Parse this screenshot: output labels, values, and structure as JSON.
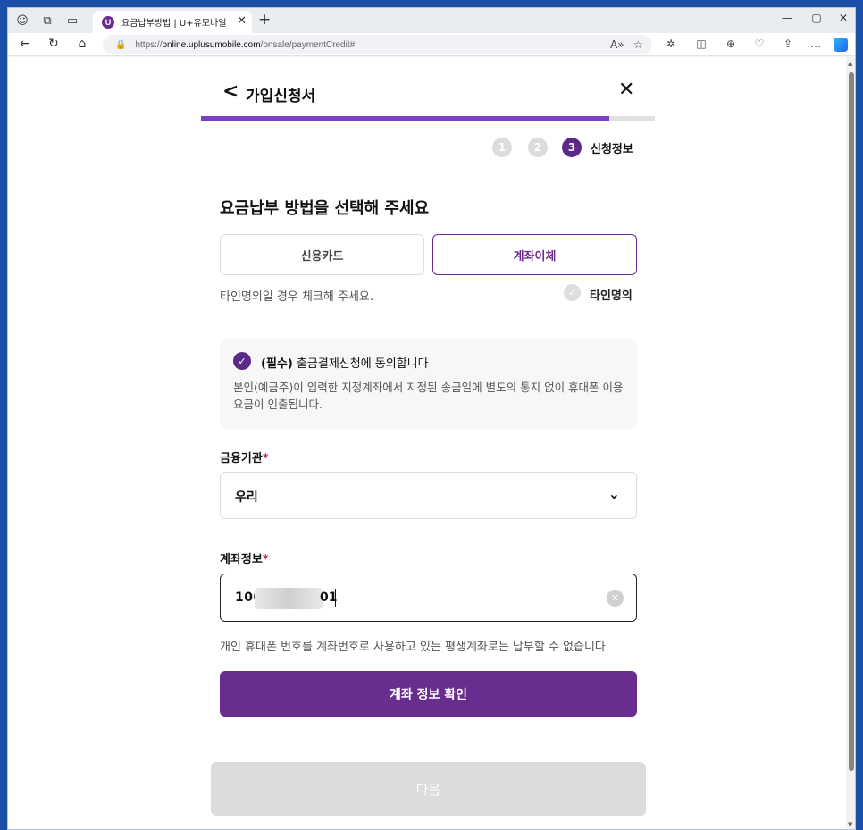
{
  "browser": {
    "tab_title": "요금납부방법 | U+유모바일",
    "tab_favicon": "U",
    "url_prefix": "https://",
    "url_host": "online.uplusumobile.com",
    "url_path": "/onsale/paymentCredit#"
  },
  "header": {
    "title": "가입신청서"
  },
  "progress": {
    "fraction": 0.9
  },
  "steps": [
    {
      "number": "1",
      "active": false
    },
    {
      "number": "2",
      "active": false
    },
    {
      "number": "3",
      "active": true,
      "label": "신청정보"
    }
  ],
  "payment": {
    "title": "요금납부 방법을 선택해 주세요",
    "options": [
      "신용카드",
      "계좌이체"
    ],
    "selected": "계좌이체",
    "hint": "타인명의일 경우 체크해 주세요.",
    "other_owner_label": "타인명의"
  },
  "agreement": {
    "required_tag": "(필수)",
    "title": "출금결제신청에 동의합니다",
    "description": "본인(예금주)이 입력한 지정계좌에서 지정된 송금일에 별도의 통지 없이 휴대폰 이용요금이 인출됩니다."
  },
  "bank_field": {
    "label": "금융기관",
    "required_mark": "*",
    "value": "우리"
  },
  "account_field": {
    "label": "계좌정보",
    "required_mark": "*",
    "value_start": "100",
    "value_end": "01"
  },
  "account_note": "개인 휴대폰 번호를 계좌번호로 사용하고 있는 평생계좌로는 납부할 수 없습니다",
  "buttons": {
    "confirm": "계좌 정보 확인",
    "next": "다음"
  },
  "colors": {
    "brand": "#682d8f",
    "progress": "#7b3fc4",
    "required": "#e0203a"
  }
}
